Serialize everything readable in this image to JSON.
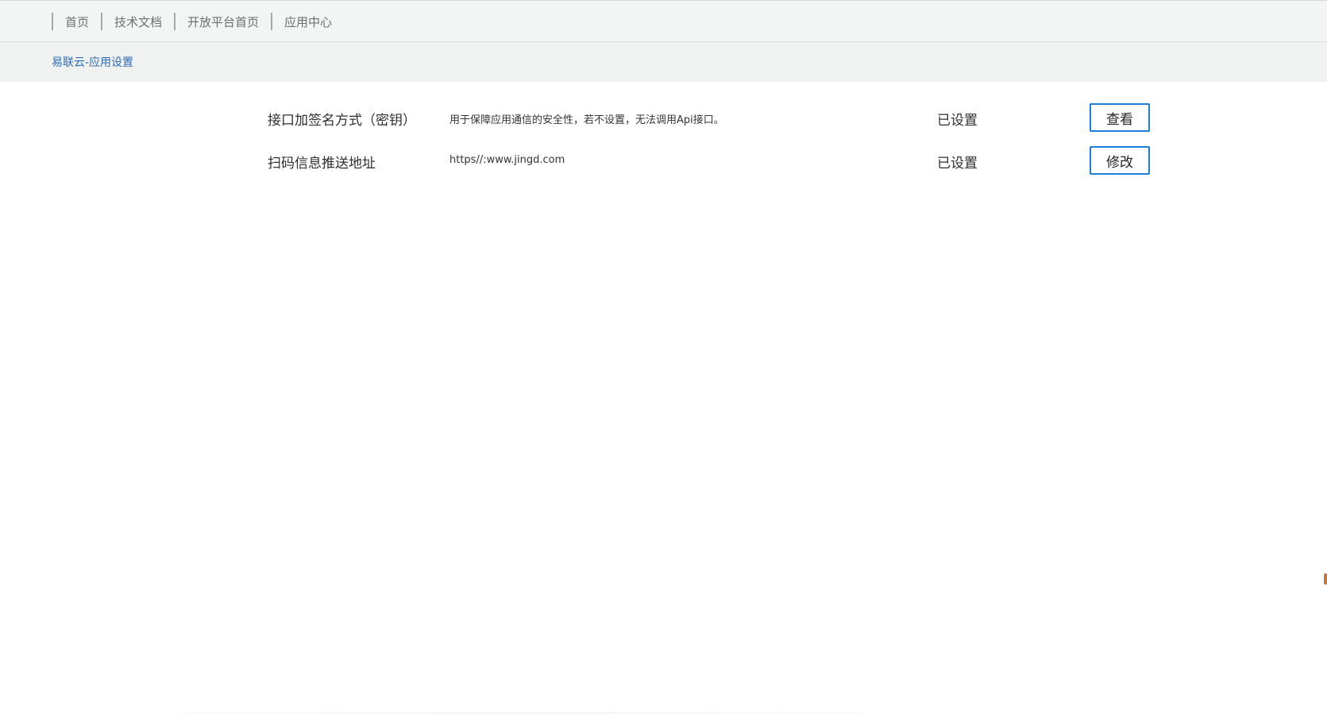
{
  "top_nav": {
    "items": [
      {
        "label": "首页"
      },
      {
        "label": "技术文档"
      },
      {
        "label": "开放平台首页"
      },
      {
        "label": "应用中心"
      }
    ]
  },
  "sub_header": {
    "title": "易联云-应用设置"
  },
  "settings": {
    "rows": [
      {
        "label": "接口加签名方式（密钥）",
        "description": "用于保障应用通信的安全性，若不设置，无法调用Api接口。",
        "status": "已设置",
        "button_label": "查看"
      },
      {
        "label": "扫码信息推送地址",
        "description": "https//:www.jingd.com",
        "status": "已设置",
        "button_label": "修改"
      }
    ]
  },
  "colors": {
    "accent_border": "#1c7fd6",
    "breadcrumb_link": "#2d6db5",
    "nav_background": "#f3f4f4"
  }
}
